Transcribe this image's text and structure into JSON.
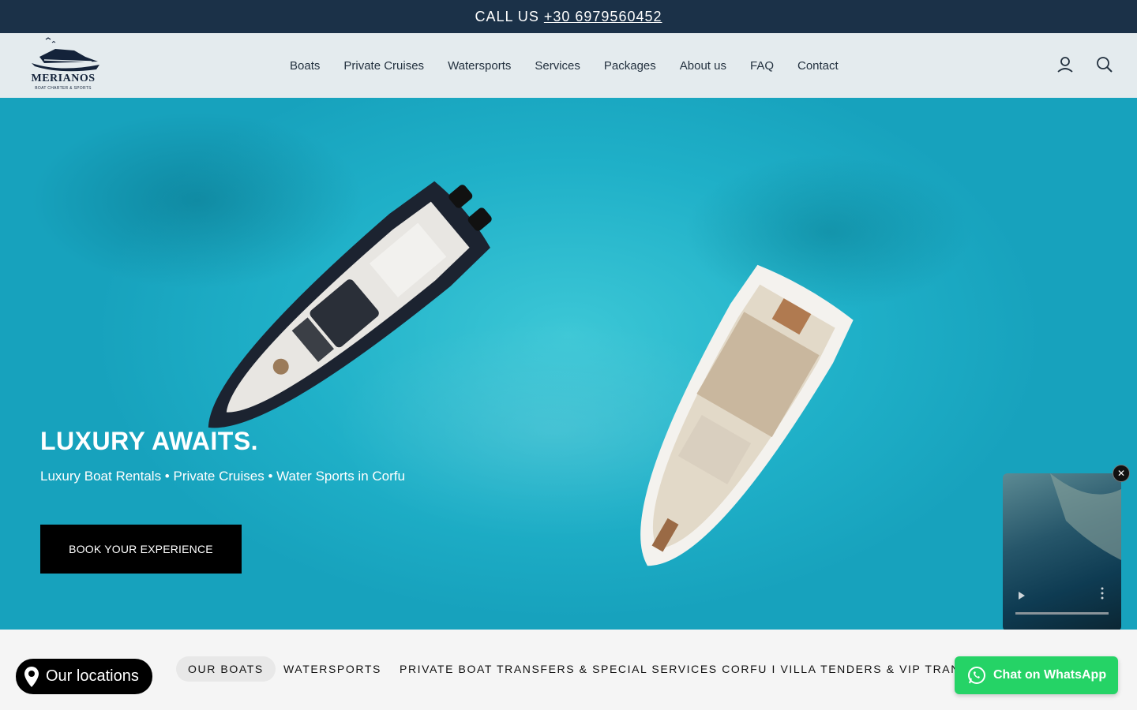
{
  "topbar": {
    "label": "CALL US",
    "phone": "+30 6979560452"
  },
  "header": {
    "logo": {
      "brand": "MERIANOS",
      "tagline": "BOAT CHARTER & SPORTS"
    },
    "nav": [
      "Boats",
      "Private Cruises",
      "Watersports",
      "Services",
      "Packages",
      "About us",
      "FAQ",
      "Contact"
    ],
    "icons": [
      "account-icon",
      "search-icon"
    ]
  },
  "hero": {
    "title": "LUXURY AWAITS.",
    "subtitle": "Luxury Boat Rentals • Private Cruises • Water Sports in Corfu",
    "cta": "BOOK YOUR EXPERIENCE"
  },
  "tabs": [
    "OUR BOATS",
    "WATERSPORTS",
    "PRIVATE BOAT TRANSFERS & SPECIAL SERVICES CORFU I VILLA TENDERS & VIP TRANSFERS"
  ],
  "floating": {
    "locations": "Our locations",
    "whatsapp": "Chat on WhatsApp"
  },
  "colors": {
    "topbar": "#1b3148",
    "header": "#e4ebee",
    "water": "#1fb0c8",
    "whatsapp": "#25d366"
  }
}
